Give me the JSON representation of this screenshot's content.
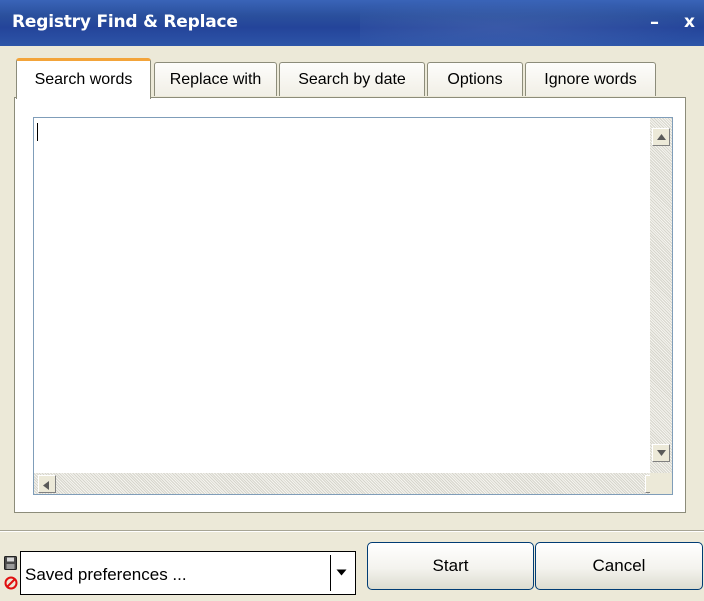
{
  "window": {
    "title": "Registry Find & Replace",
    "minimize_glyph": "–",
    "close_glyph": "x"
  },
  "tabs": [
    {
      "label": "Search words",
      "active": true
    },
    {
      "label": "Replace with",
      "active": false
    },
    {
      "label": "Search by date",
      "active": false
    },
    {
      "label": "Options",
      "active": false
    },
    {
      "label": "Ignore words",
      "active": false
    }
  ],
  "editor": {
    "value": ""
  },
  "footer": {
    "preferences_value": "Saved preferences ...",
    "start_label": "Start",
    "cancel_label": "Cancel"
  },
  "icons": {
    "save": "floppy-disk-icon",
    "delete": "no-entry-icon",
    "dropdown": "chevron-down-icon"
  },
  "colors": {
    "titlebar": "#2a4f9c",
    "active_tab_accent": "#f3a43a",
    "window_bg": "#ECE9D8"
  }
}
